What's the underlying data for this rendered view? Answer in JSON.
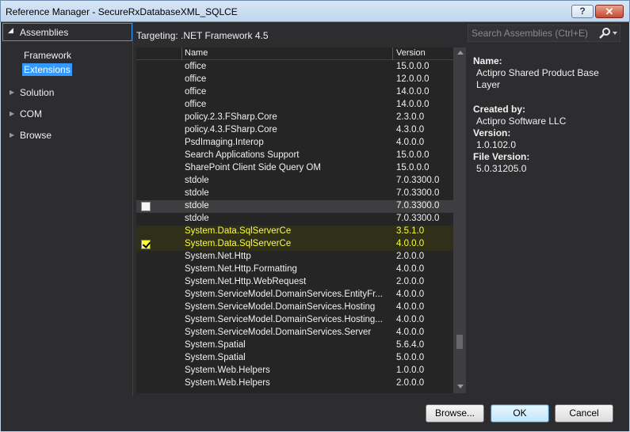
{
  "window": {
    "title": "Reference Manager - SecureRxDatabaseXML_SQLCE",
    "help_label": "?",
    "close_label": "✕"
  },
  "nav": {
    "section": "Assemblies",
    "sub_items": [
      {
        "label": "Framework",
        "selected": false
      },
      {
        "label": "Extensions",
        "selected": true
      }
    ],
    "categories": [
      "Solution",
      "COM",
      "Browse"
    ]
  },
  "targeting": "Targeting: .NET Framework 4.5",
  "search": {
    "placeholder": "Search Assemblies (Ctrl+E)",
    "icon": "search-icon"
  },
  "list": {
    "columns": {
      "name": "Name",
      "version": "Version"
    },
    "rows": [
      {
        "name": "office",
        "version": "15.0.0.0"
      },
      {
        "name": "office",
        "version": "12.0.0.0"
      },
      {
        "name": "office",
        "version": "14.0.0.0"
      },
      {
        "name": "office",
        "version": "14.0.0.0"
      },
      {
        "name": "policy.2.3.FSharp.Core",
        "version": "2.3.0.0"
      },
      {
        "name": "policy.4.3.FSharp.Core",
        "version": "4.3.0.0"
      },
      {
        "name": "PsdImaging.Interop",
        "version": "4.0.0.0"
      },
      {
        "name": "Search Applications Support",
        "version": "15.0.0.0"
      },
      {
        "name": "SharePoint Client Side Query OM",
        "version": "15.0.0.0"
      },
      {
        "name": "stdole",
        "version": "7.0.3300.0"
      },
      {
        "name": "stdole",
        "version": "7.0.3300.0"
      },
      {
        "name": "stdole",
        "version": "7.0.3300.0",
        "state": "hover"
      },
      {
        "name": "stdole",
        "version": "7.0.3300.0"
      },
      {
        "name": "System.Data.SqlServerCe",
        "version": "3.5.1.0",
        "state": "added"
      },
      {
        "name": "System.Data.SqlServerCe",
        "version": "4.0.0.0",
        "state": "added-checked"
      },
      {
        "name": "System.Net.Http",
        "version": "2.0.0.0"
      },
      {
        "name": "System.Net.Http.Formatting",
        "version": "4.0.0.0"
      },
      {
        "name": "System.Net.Http.WebRequest",
        "version": "2.0.0.0"
      },
      {
        "name": "System.ServiceModel.DomainServices.EntityFr...",
        "version": "4.0.0.0"
      },
      {
        "name": "System.ServiceModel.DomainServices.Hosting",
        "version": "4.0.0.0"
      },
      {
        "name": "System.ServiceModel.DomainServices.Hosting...",
        "version": "4.0.0.0"
      },
      {
        "name": "System.ServiceModel.DomainServices.Server",
        "version": "4.0.0.0"
      },
      {
        "name": "System.Spatial",
        "version": "5.6.4.0"
      },
      {
        "name": "System.Spatial",
        "version": "5.0.0.0"
      },
      {
        "name": "System.Web.Helpers",
        "version": "1.0.0.0"
      },
      {
        "name": "System.Web.Helpers",
        "version": "2.0.0.0"
      }
    ]
  },
  "details": {
    "name_label": "Name:",
    "name_value": "Actipro Shared Product Base Layer",
    "created_label": "Created by:",
    "created_value": "Actipro Software LLC",
    "version_label": "Version:",
    "version_value": "1.0.102.0",
    "file_version_label": "File Version:",
    "file_version_value": "5.0.31205.0"
  },
  "buttons": {
    "browse": "Browse...",
    "ok": "OK",
    "cancel": "Cancel"
  },
  "colors": {
    "accent": "#3399ff",
    "added_text": "#ffff33",
    "background": "#2d2d30"
  }
}
